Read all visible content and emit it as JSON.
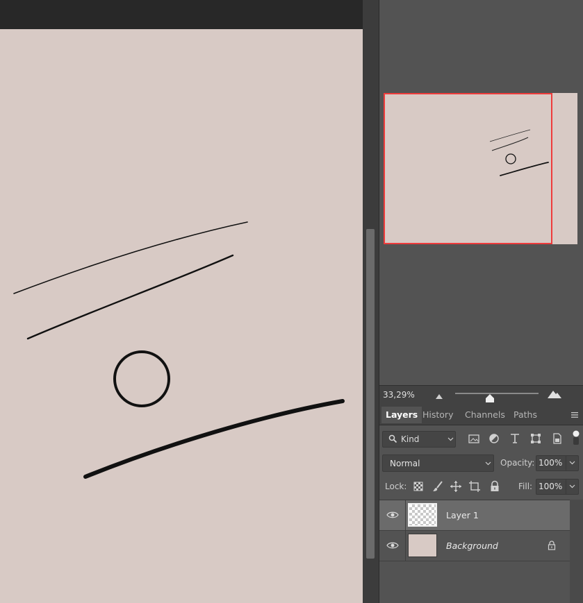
{
  "navigator": {
    "zoom_value": "33,29%",
    "zoom_out_icon": "small-mountain-icon",
    "zoom_in_icon": "large-mountain-icon"
  },
  "tabs": [
    "Layers",
    "History",
    "Channels",
    "Paths"
  ],
  "filter": {
    "kind_label": "Kind",
    "icons": [
      "image-filter-icon",
      "adjustment-filter-icon",
      "type-filter-icon",
      "shape-filter-icon",
      "smart-object-filter-icon",
      "filter-toggle-icon"
    ]
  },
  "blend": {
    "mode": "Normal",
    "opacity_label": "Opacity:",
    "opacity_value": "100%"
  },
  "lock": {
    "label": "Lock:",
    "icons": [
      "lock-transparency-icon",
      "lock-paint-icon",
      "lock-position-icon",
      "lock-artboard-icon",
      "lock-all-icon"
    ],
    "fill_label": "Fill:",
    "fill_value": "100%"
  },
  "layers": [
    {
      "name": "Layer 1",
      "visible": true,
      "selected": true,
      "locked": false
    },
    {
      "name": "Background",
      "visible": true,
      "selected": false,
      "locked": true
    }
  ],
  "colors": {
    "canvas": "#d8cac5",
    "navigator_frame": "#ee3b3b",
    "panel_bg": "#535353",
    "selected_layer": "#6b6b6b"
  }
}
